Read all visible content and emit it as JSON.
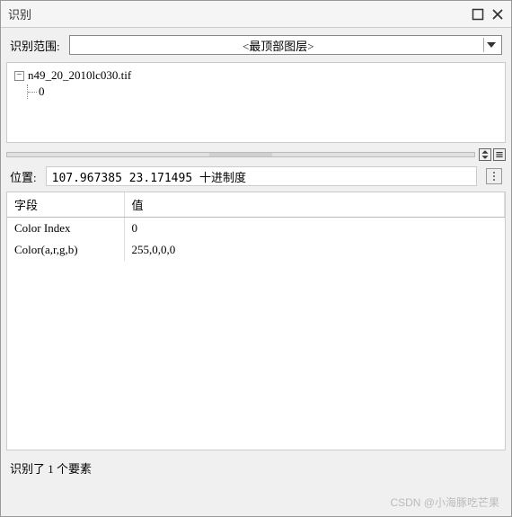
{
  "title_bar": {
    "title": "识别"
  },
  "scope": {
    "label": "识别范围:",
    "selected": "<最顶部图层>"
  },
  "tree": {
    "root": "n49_20_2010lc030.tif",
    "child": "0"
  },
  "position": {
    "label": "位置:",
    "value": "107.967385  23.171495 十进制度"
  },
  "table": {
    "headers": {
      "field": "字段",
      "value": "值"
    },
    "rows": [
      {
        "field": "Color Index",
        "value": "0"
      },
      {
        "field": "Color(a,r,g,b)",
        "value": "255,0,0,0"
      }
    ]
  },
  "status": "识别了 1 个要素",
  "watermark": "CSDN @小海豚吃芒果"
}
